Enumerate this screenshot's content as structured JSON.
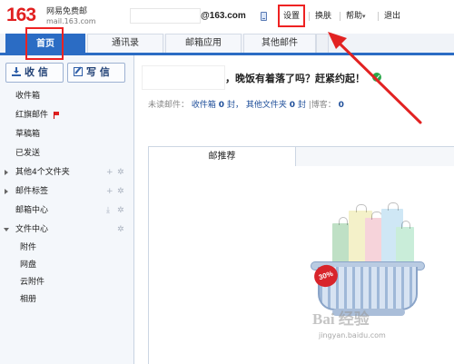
{
  "header": {
    "logo_number": "163",
    "logo_name": "网易免费邮",
    "logo_domain": "mail.163.com",
    "account_domain": "@163.com",
    "links": {
      "settings": "设置",
      "switch": "换肤",
      "help": "帮助",
      "logout": "退出"
    },
    "help_caret": "▾"
  },
  "tabs": {
    "home": "首页",
    "contacts": "通讯录",
    "apps": "邮箱应用",
    "other_mail": "其他邮件"
  },
  "sidebar": {
    "receive": "收 信",
    "compose": "写 信",
    "items": [
      {
        "label": "收件箱"
      },
      {
        "label": "红旗邮件"
      },
      {
        "label": "草稿箱"
      },
      {
        "label": "已发送"
      },
      {
        "label": "其他4个文件夹"
      },
      {
        "label": "邮件标签"
      },
      {
        "label": "邮箱中心"
      },
      {
        "label": "文件中心"
      },
      {
        "label": "附件"
      },
      {
        "label": "网盘"
      },
      {
        "label": "云附件"
      },
      {
        "label": "相册"
      }
    ],
    "actions": {
      "add": "+",
      "gear": "✲",
      "download": "⤓"
    }
  },
  "main": {
    "greeting": "，晚饭有着落了吗？赶紧约起！",
    "stats": {
      "unread_label": "未读邮件：",
      "inbox_label": "收件箱",
      "inbox_count": "0",
      "inbox_unit": "封",
      "other_label": "其他文件夹",
      "other_count": "0",
      "other_unit": "封",
      "guest_label": "|博客：",
      "guest_count": "0"
    },
    "panel_tab": "邮推荐",
    "sale_badge": "30%"
  },
  "watermark": {
    "brand": "Bai 经验",
    "url": "jingyan.baidu.com"
  },
  "colors": {
    "brand_red": "#e11f1f",
    "tab_blue": "#2b6cc4",
    "annotation_red": "#e22222",
    "link_blue": "#1f4f9a"
  }
}
